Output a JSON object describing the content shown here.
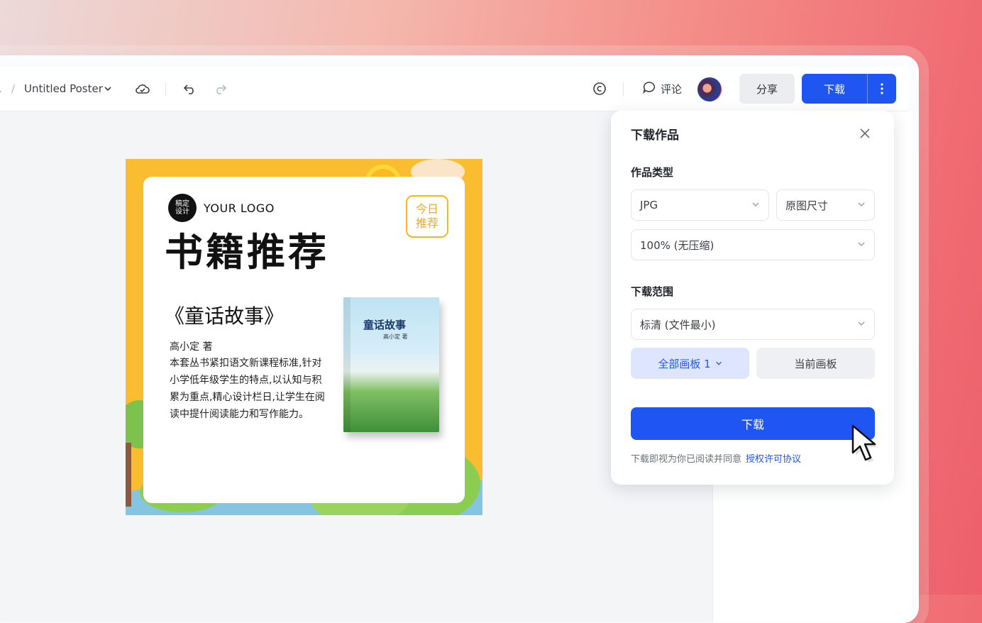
{
  "topbar": {
    "crumb_left": ".",
    "crumb_sep": "/",
    "poster_name": "Untitled Poster",
    "comment_label": "评论",
    "share_label": "分享",
    "download_label": "下载"
  },
  "poster": {
    "logo_badge": "稿定\n设计",
    "logo_text": "YOUR LOGO",
    "title": "书籍推荐",
    "today_badge": "今日\n推荐",
    "book_title": "《童话故事》",
    "author": "高小定 著",
    "description": "本套丛书紧扣语文新课程标准,针对小学低年级学生的特点,以认知与积累为重点,精心设计栏日,让学生在阅读中提什阅读能力和写作能力。",
    "cover_title": "童话故事",
    "cover_subtitle": "高小定 著"
  },
  "download_panel": {
    "title": "下载作品",
    "type_label": "作品类型",
    "format_value": "JPG",
    "size_value": "原图尺寸",
    "quality_value": "100% (无压缩)",
    "range_label": "下载范围",
    "resolution_value": "标清 (文件最小)",
    "all_boards_label": "全部画板 1",
    "current_board_label": "当前画板",
    "download_button": "下载",
    "agreement_text": "下载即视为你已阅读并同意",
    "agreement_link": "授权许可协议"
  },
  "colors": {
    "accent": "#1f55f0",
    "poster_border": "#fbbd30"
  }
}
